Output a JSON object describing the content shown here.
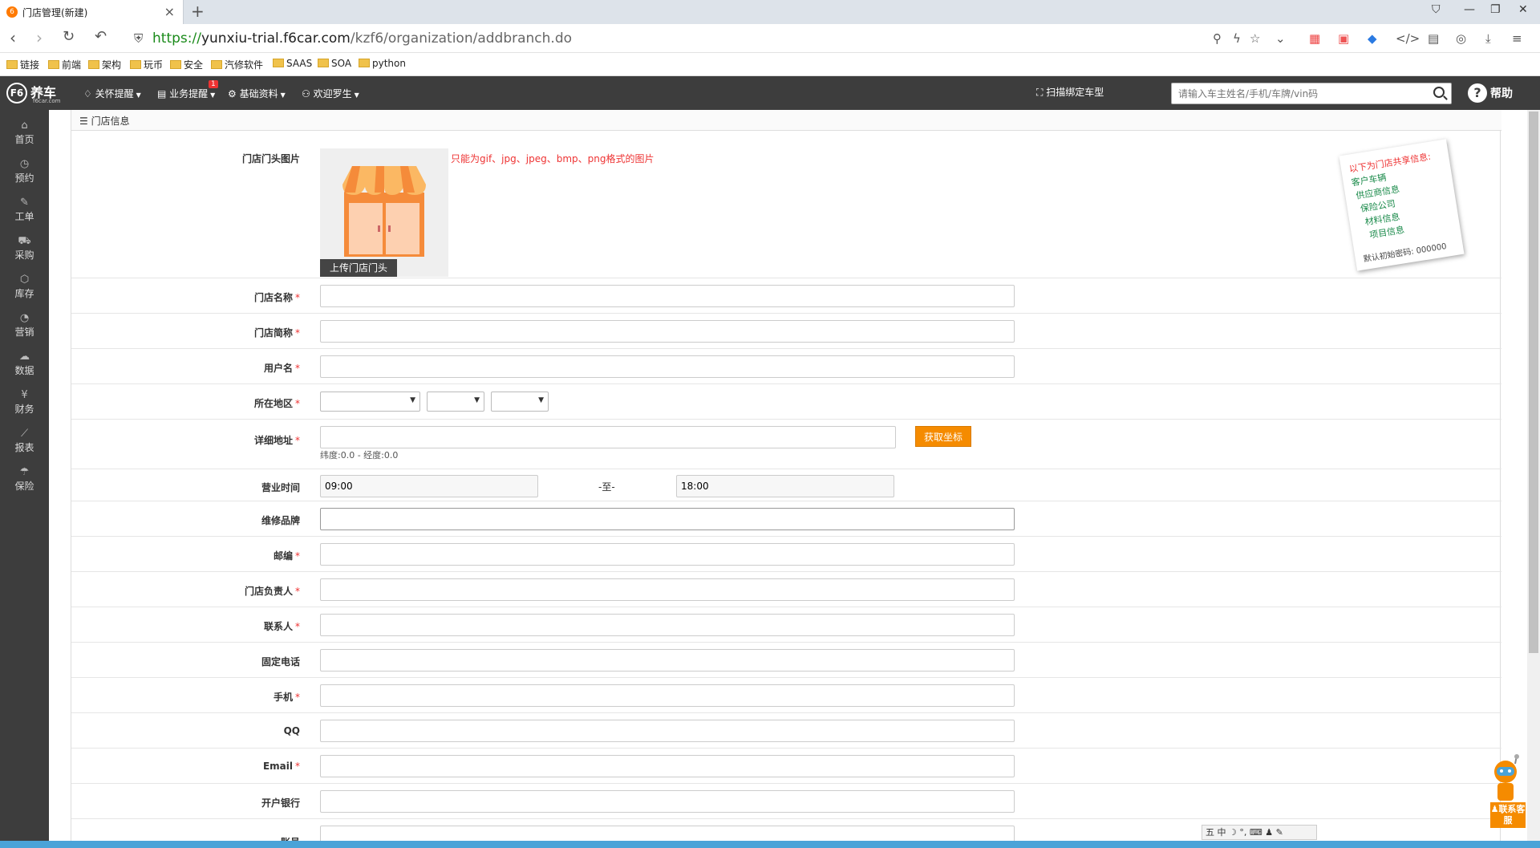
{
  "browser": {
    "tab_title": "门店管理(新建)",
    "url_scheme": "https://",
    "url_host": "yunxiu-trial.f6car.com",
    "url_path": "/kzf6/organization/addbranch.do",
    "bookmarks": [
      "链接",
      "前端",
      "架构",
      "玩币",
      "安全",
      "汽修软件",
      "SAAS",
      "SOA",
      "python"
    ]
  },
  "header": {
    "logo_name": "养车",
    "logo_sub": "f6car.com",
    "menu": [
      "关怀提醒",
      "业务提醒",
      "基础资料",
      "欢迎罗生"
    ],
    "badge": "1",
    "scan_link": "扫描绑定车型",
    "search_placeholder": "请输入车主姓名/手机/车牌/vin码",
    "help": "帮助"
  },
  "sidebar": [
    {
      "label": "首页",
      "icon": "home-icon",
      "glyph": "⌂"
    },
    {
      "label": "预约",
      "icon": "clock-icon",
      "glyph": "◷"
    },
    {
      "label": "工单",
      "icon": "wrench-icon",
      "glyph": "✎"
    },
    {
      "label": "采购",
      "icon": "cart-icon",
      "glyph": "⛟"
    },
    {
      "label": "库存",
      "icon": "box-icon",
      "glyph": "⬡"
    },
    {
      "label": "营销",
      "icon": "chart-pie-icon",
      "glyph": "◔"
    },
    {
      "label": "数据",
      "icon": "cloud-icon",
      "glyph": "☁"
    },
    {
      "label": "财务",
      "icon": "yen-icon",
      "glyph": "¥"
    },
    {
      "label": "报表",
      "icon": "line-chart-icon",
      "glyph": "⟋"
    },
    {
      "label": "保险",
      "icon": "umbrella-icon",
      "glyph": "☂"
    }
  ],
  "panel": {
    "title": "门店信息"
  },
  "form": {
    "storefront_label": "门店门头图片",
    "upload_label": "上传门店门头",
    "image_hint": "只能为gif、jpg、jpeg、bmp、png格式的图片",
    "name_label": "门店名称",
    "short_label": "门店简称",
    "username_label": "用户名",
    "region_label": "所在地区",
    "address_label": "详细地址",
    "get_coords": "获取坐标",
    "coords_text": "纬度:0.0 - 经度:0.0",
    "hours_label": "营业时间",
    "hours_start": "09:00",
    "hours_sep": "-至-",
    "hours_end": "18:00",
    "brand_label": "维修品牌",
    "zip_label": "邮编",
    "manager_label": "门店负责人",
    "contact_label": "联系人",
    "phone_label": "固定电话",
    "mobile_label": "手机",
    "qq_label": "QQ",
    "email_label": "Email",
    "bank_label": "开户银行",
    "account_label": "账号",
    "required_mark": "*"
  },
  "note": {
    "heading": "以下为门店共享信息:",
    "items": [
      "客户车辆",
      "供应商信息",
      "保险公司",
      "材料信息",
      "项目信息"
    ],
    "password": "默认初始密码: 000000"
  },
  "widgets": {
    "chat": "联系客服",
    "ime": "五 中 ☽ °, ⌨ ♟ ✎"
  }
}
